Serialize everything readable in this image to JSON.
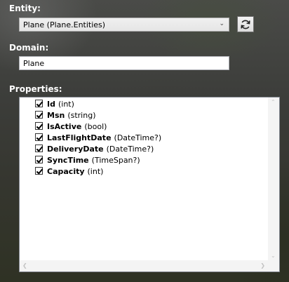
{
  "entity": {
    "label": "Entity:",
    "selected": "Plane (Plane.Entities)",
    "refresh_icon": "refresh-icon"
  },
  "domain": {
    "label": "Domain:",
    "value": "Plane"
  },
  "properties": {
    "label": "Properties:",
    "items": [
      {
        "name": "Id",
        "type": "(int)",
        "checked": true
      },
      {
        "name": "Msn",
        "type": "(string)",
        "checked": true
      },
      {
        "name": "IsActive",
        "type": "(bool)",
        "checked": true
      },
      {
        "name": "LastFlightDate",
        "type": "(DateTime?)",
        "checked": true
      },
      {
        "name": "DeliveryDate",
        "type": "(DateTime?)",
        "checked": true
      },
      {
        "name": "SyncTime",
        "type": "(TimeSpan?)",
        "checked": true
      },
      {
        "name": "Capacity",
        "type": "(int)",
        "checked": true
      }
    ]
  },
  "icons": {
    "dropdown": "chevron-down-icon",
    "scroll_up": "scroll-up-arrow-icon",
    "scroll_down": "scroll-down-arrow-icon",
    "scroll_left": "scroll-left-arrow-icon",
    "scroll_right": "scroll-right-arrow-icon"
  }
}
